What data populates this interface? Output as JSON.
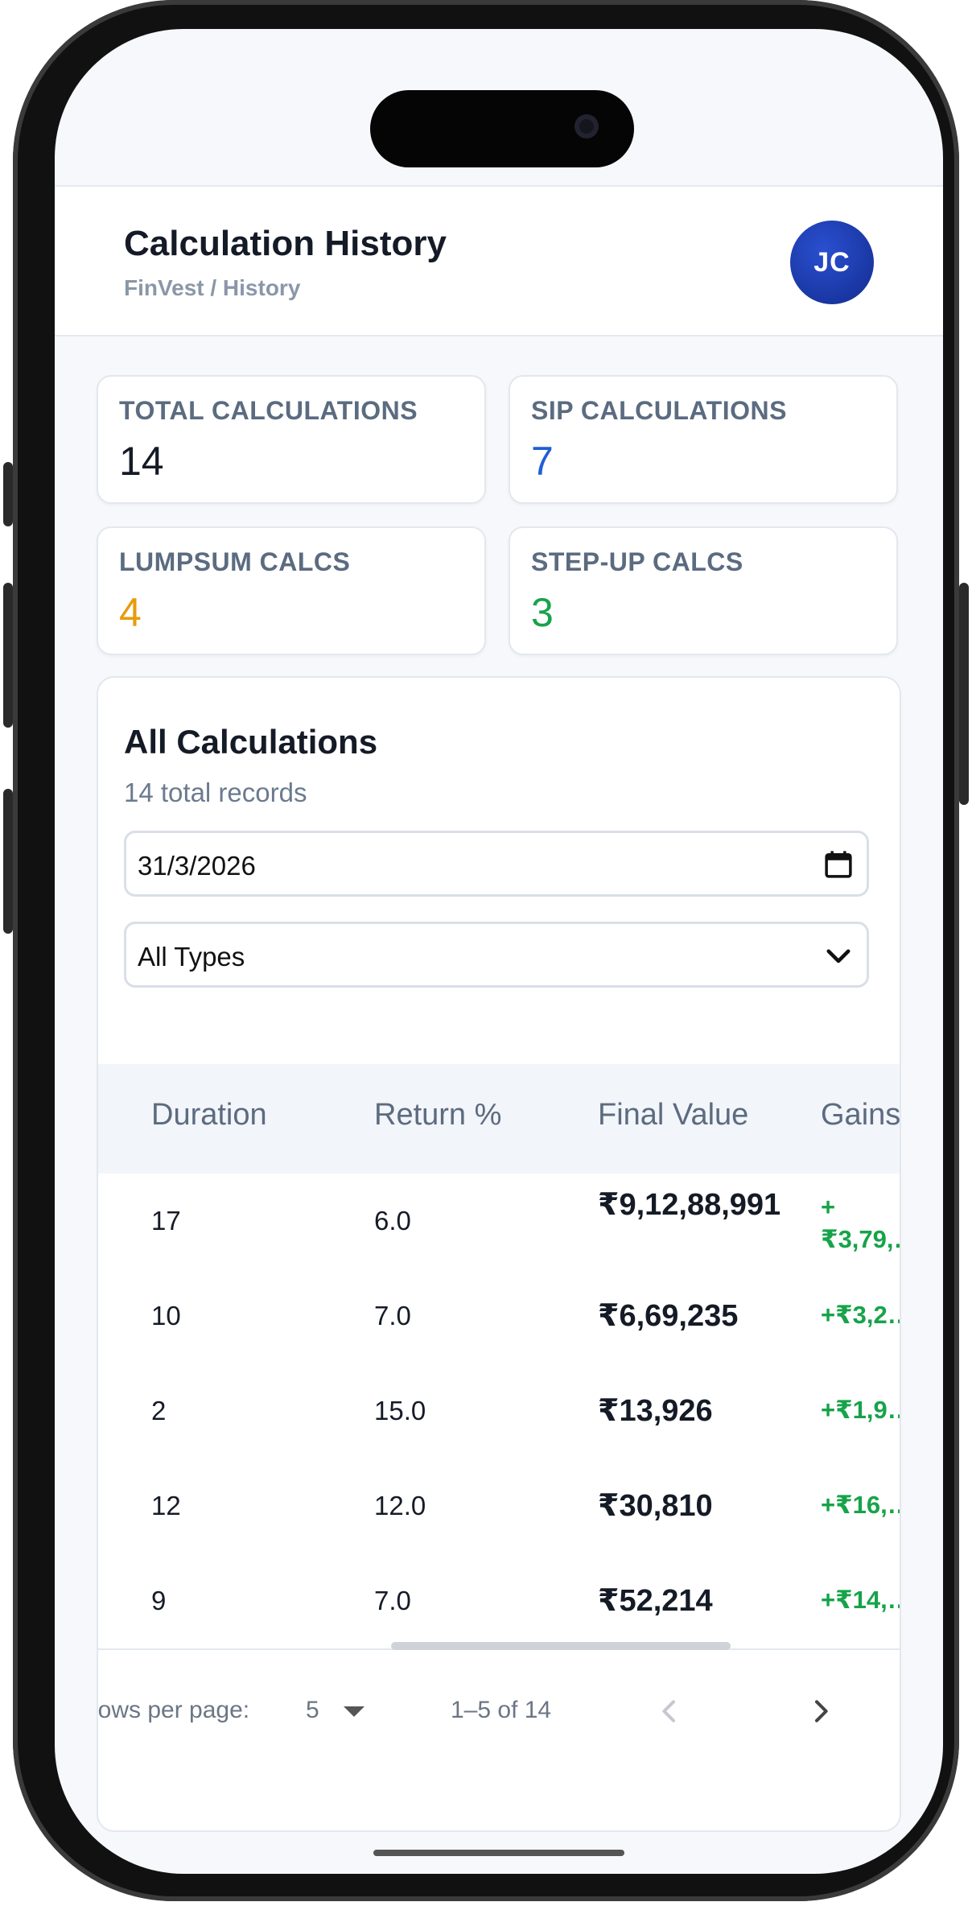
{
  "header": {
    "title": "Calculation History",
    "breadcrumb": "FinVest / History",
    "avatar_initials": "JC"
  },
  "stats": [
    {
      "label": "TOTAL CALCULATIONS",
      "value": "14",
      "color": "#151b26"
    },
    {
      "label": "SIP CALCULATIONS",
      "value": "7",
      "color": "#1f5fd6"
    },
    {
      "label": "LUMPSUM CALCS",
      "value": "4",
      "color": "#e89b0c"
    },
    {
      "label": "STEP-UP CALCS",
      "value": "3",
      "color": "#17a34a"
    }
  ],
  "card": {
    "title": "All Calculations",
    "subtitle": "14 total records",
    "date_value": "31/3/2026",
    "type_filter": "All Types"
  },
  "table": {
    "columns": [
      "Duration",
      "Return %",
      "Final Value",
      "Gains"
    ],
    "rows": [
      {
        "duration": "17",
        "return": "6.0",
        "final_value": "₹9,12,88,991",
        "gains": "+₹3,79,…"
      },
      {
        "duration": "10",
        "return": "7.0",
        "final_value": "₹6,69,235",
        "gains": "+₹3,2…"
      },
      {
        "duration": "2",
        "return": "15.0",
        "final_value": "₹13,926",
        "gains": "+₹1,9…"
      },
      {
        "duration": "12",
        "return": "12.0",
        "final_value": "₹30,810",
        "gains": "+₹16,…"
      },
      {
        "duration": "9",
        "return": "7.0",
        "final_value": "₹52,214",
        "gains": "+₹14,…"
      }
    ]
  },
  "pagination": {
    "rows_per_page_label": "Rows per page:",
    "rows_per_page": "5",
    "range": "1–5 of 14"
  },
  "colors": {
    "accent": "#1f5fd6",
    "gain": "#17a34a",
    "warning": "#e89b0c"
  }
}
